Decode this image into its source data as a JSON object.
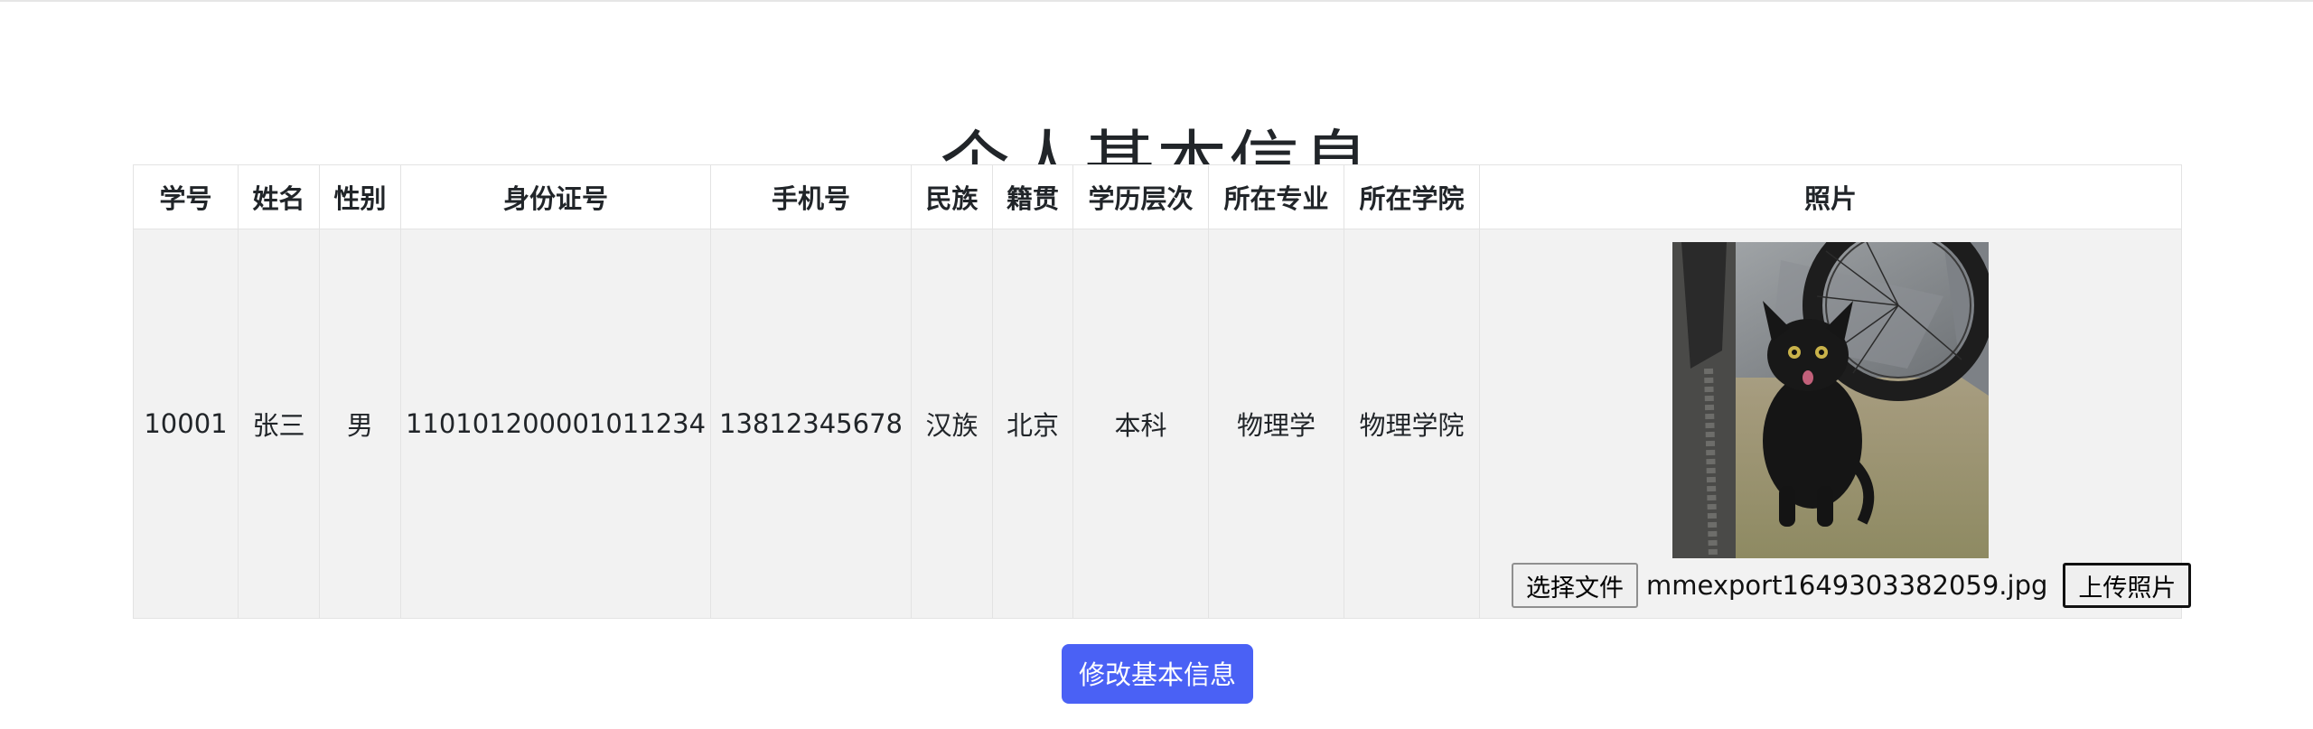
{
  "page": {
    "title": "个人基本信息",
    "modify_button": "修改基本信息"
  },
  "table": {
    "headers": [
      "学号",
      "姓名",
      "性别",
      "身份证号",
      "手机号",
      "民族",
      "籍贯",
      "学历层次",
      "所在专业",
      "所在学院",
      "照片"
    ],
    "row": [
      "10001",
      "张三",
      "男",
      "110101200001011234",
      "13812345678",
      "汉族",
      "北京",
      "本科",
      "物理学",
      "物理学院"
    ]
  },
  "photo": {
    "choose_file_label": "选择文件",
    "file_name": "mmexport1649303382059.jpg",
    "upload_label": "上传照片"
  },
  "colors": {
    "accent": "#4a61f5",
    "row_background": "#f2f2f2",
    "border": "#e3e3e3"
  }
}
